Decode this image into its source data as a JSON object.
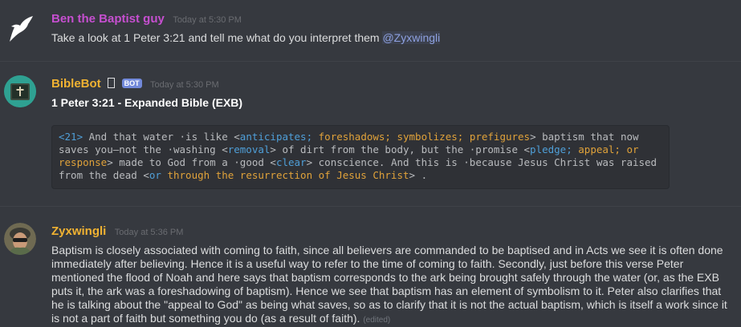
{
  "messages": [
    {
      "author": "Ben the Baptist guy",
      "author_color": "#c64fd0",
      "timestamp": "Today at 5:30 PM",
      "text": "Take a look at 1 Peter 3:21 and tell me what do you interpret them",
      "mention": "@Zyxwingli"
    },
    {
      "author": "BibleBot",
      "author_color": "#f0b232",
      "badge": "BOT",
      "timestamp": "Today at 5:30 PM",
      "heading": "1 Peter 3:21 - Expanded Bible (EXB)",
      "verse": {
        "ref": "<21>",
        "seg1": " And that water ·is like ",
        "br1_open": "<",
        "ant": "anticipates;",
        "fore": "foreshadows;",
        "sym": "symbolizes;",
        "pref": "prefigures",
        "br1_close": ">",
        "seg2": " baptism that now saves you—not the ·washing ",
        "rem_open": "<",
        "removal": "removal",
        "rem_close": ">",
        "seg3": " of dirt from the body, but the ·promise ",
        "pl_open": "<",
        "pledge": "pledge;",
        "appeal": "appeal;",
        "or": "or",
        "response": "response",
        "pl_close": ">",
        "seg4": " made to God from a ·good ",
        "cl_open": "<",
        "clear": "clear",
        "cl_close": ">",
        "seg5": " conscience. And this is ·because Jesus Christ was raised from the dead ",
        "or2_open": "<",
        "or2": "or",
        "through": "through the resurrection of Jesus Christ",
        "or2_close": ">",
        "seg6": " ."
      }
    },
    {
      "author": "Zyxwingli",
      "author_color": "#f0b232",
      "timestamp": "Today at 5:36 PM",
      "text": "Baptism is closely associated with coming to faith, since all believers are commanded to be baptised and in Acts we see it is often done immediately after believing. Hence it is a useful way to refer to the time of coming to faith. Secondly, just before this verse Peter mentioned the flood of Noah and here says that baptism corresponds to the ark being brought safely through the water (or, as the EXB puts it, the ark was a foreshadowing of baptism). Hence we see that baptism has an element of symbolism to it. Peter also clarifies that he is talking about the \"appeal to God\" as being what saves, so as to clarify that it is not the actual baptism, which is itself a work since it is not a part of faith but something you do (as a result of faith).",
      "edited": "(edited)"
    }
  ]
}
